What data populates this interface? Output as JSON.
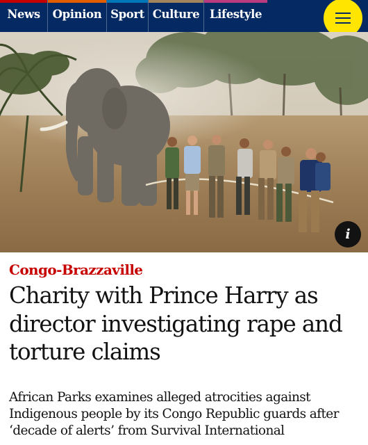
{
  "nav": {
    "items": [
      {
        "label": "News",
        "accent": "#c70000"
      },
      {
        "label": "Opinion",
        "accent": "#e05e00"
      },
      {
        "label": "Sport",
        "accent": "#0077b6"
      },
      {
        "label": "Culture",
        "accent": "#a1845c"
      },
      {
        "label": "Lifestyle",
        "accent": "#bb3b80"
      }
    ],
    "menu_icon": "hamburger-menu-icon",
    "background": "#052962",
    "menu_color": "#ffe500"
  },
  "hero": {
    "info_label": "i",
    "info_icon": "info-icon"
  },
  "article": {
    "kicker": "Congo-Brazzaville",
    "kicker_color": "#c70000",
    "headline": "Charity with Prince Harry as director investigating rape and torture claims",
    "standfirst": "African Parks examines alleged atrocities against Indigenous people by its Congo Republic guards after ‘decade of alerts’ from Survival International"
  }
}
